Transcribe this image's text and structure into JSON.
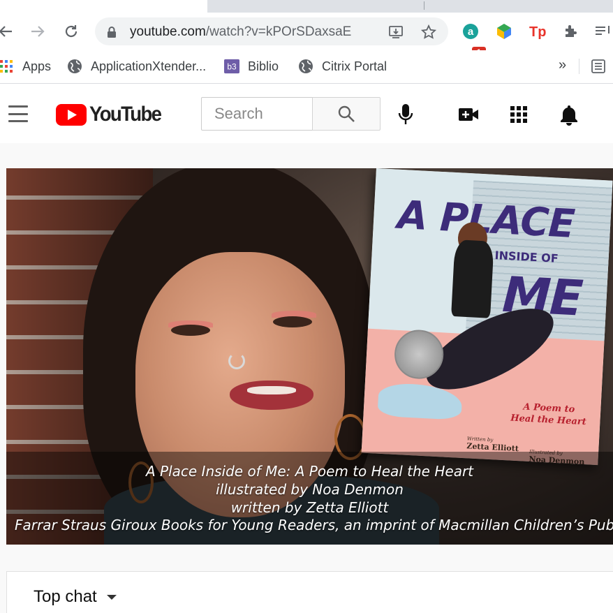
{
  "browser": {
    "url_host": "youtube.com",
    "url_rest": "/watch?v=kPOrSDaxsaE",
    "extension_badge": "1"
  },
  "bookmarks": {
    "items": [
      {
        "label": "Apps",
        "icon": "apps-grid-icon"
      },
      {
        "label": "ApplicationXtender...",
        "icon": "globe-icon"
      },
      {
        "label": "Biblio",
        "icon": "biblio-icon"
      },
      {
        "label": "Citrix Portal",
        "icon": "globe-icon"
      }
    ],
    "overflow": "»"
  },
  "youtube": {
    "logo_text": "YouTube",
    "search_placeholder": "Search"
  },
  "video": {
    "book": {
      "title_a": "A PLACE",
      "title_b": "INSIDE OF",
      "title_c": "ME",
      "subtitle": "A Poem to Heal the Heart",
      "written_by_label": "Written by",
      "author": "Zetta Elliott",
      "illustrated_by_label": "Illustrated by",
      "illustrator": "Noa Denmon"
    },
    "caption": {
      "line1": "A Place Inside of Me: A Poem to Heal the Heart",
      "line2": "illustrated by Noa Denmon",
      "line3": "written by Zetta Elliott",
      "line4": "Farrar Straus Giroux Books for Young Readers, an imprint of Macmillan Children’s Publishing"
    }
  },
  "chat": {
    "label": "Top chat"
  },
  "colors": {
    "youtube_red": "#ff0000",
    "book_title": "#3d2c7a",
    "book_subtitle": "#b7202e"
  }
}
